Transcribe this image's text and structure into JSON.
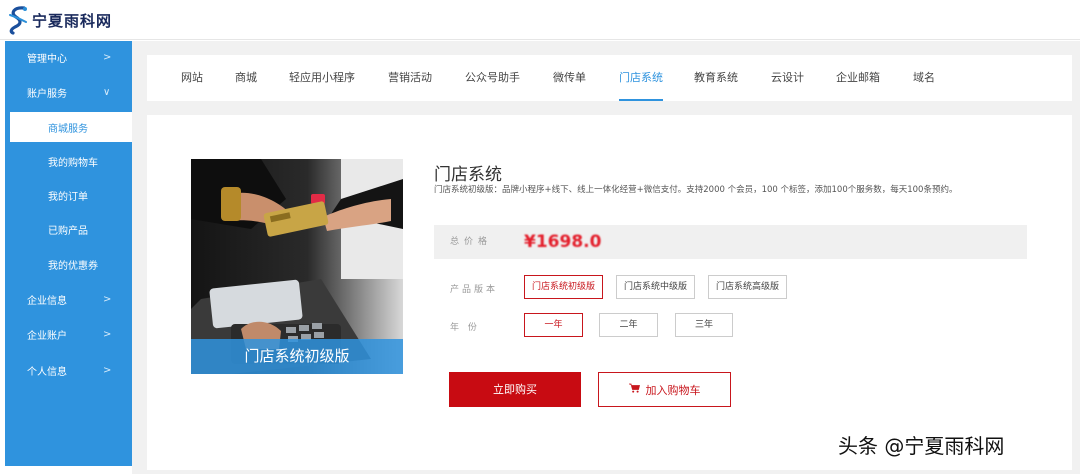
{
  "brand": {
    "name": "宁夏雨科网"
  },
  "sidebar": {
    "items": [
      {
        "label": "管理中心",
        "arrow": ">"
      },
      {
        "label": "账户服务",
        "arrow": "∨"
      },
      {
        "label": "商城服务"
      },
      {
        "label": "我的购物车"
      },
      {
        "label": "我的订单"
      },
      {
        "label": "已购产品"
      },
      {
        "label": "我的优惠券"
      },
      {
        "label": "企业信息",
        "arrow": ">"
      },
      {
        "label": "企业账户",
        "arrow": ">"
      },
      {
        "label": "个人信息",
        "arrow": ">"
      }
    ]
  },
  "tabs": [
    {
      "label": "网站"
    },
    {
      "label": "商城"
    },
    {
      "label": "轻应用小程序"
    },
    {
      "label": "营销活动"
    },
    {
      "label": "公众号助手"
    },
    {
      "label": "微传单"
    },
    {
      "label": "门店系统"
    },
    {
      "label": "教育系统"
    },
    {
      "label": "云设计"
    },
    {
      "label": "企业邮箱"
    },
    {
      "label": "域名"
    }
  ],
  "product": {
    "image_caption": "门店系统初级版",
    "title": "门店系统",
    "description": "门店系统初级版：品牌小程序+线下、线上一体化经营+微信支付。支持2000 个会员，100 个标签，添加100个服务数，每天100条预约。",
    "price_label": "总价格",
    "price": "¥1698.0",
    "version_label": "产品版本",
    "versions": [
      "门店系统初级版",
      "门店系统中级版",
      "门店系统高级版"
    ],
    "year_label": "年  份",
    "years": [
      "一年",
      "二年",
      "三年"
    ],
    "buy_label": "立即购买",
    "cart_label": "加入购物车"
  },
  "watermark": "头条 @宁夏雨科网",
  "colors": {
    "accent": "#2f93de",
    "buy": "#c80b12",
    "price": "#e31e2b"
  }
}
